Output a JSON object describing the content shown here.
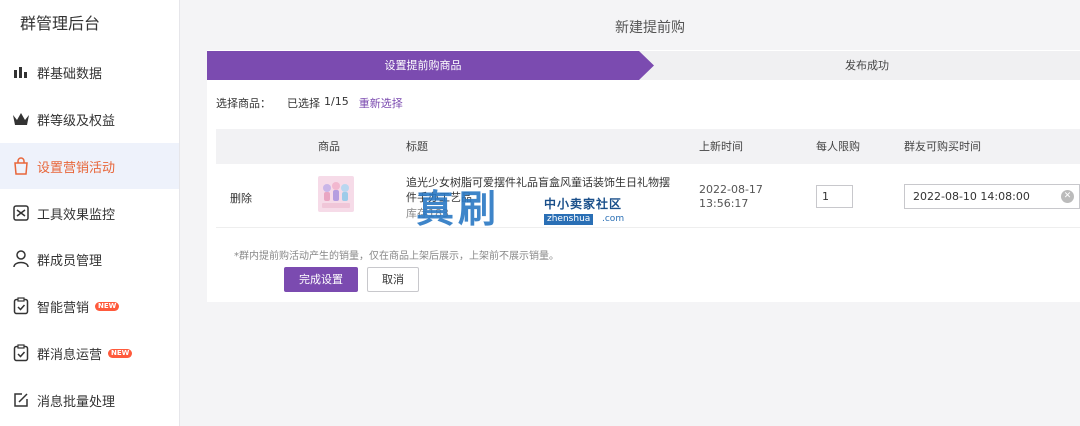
{
  "sidebar": {
    "title": "群管理后台",
    "items": [
      {
        "label": "群基础数据",
        "icon": "bar-chart-icon",
        "active": false,
        "badge": ""
      },
      {
        "label": "群等级及权益",
        "icon": "crown-icon",
        "active": false,
        "badge": ""
      },
      {
        "label": "设置营销活动",
        "icon": "shopping-bag-icon",
        "active": true,
        "badge": ""
      },
      {
        "label": "工具效果监控",
        "icon": "monitor-icon",
        "active": false,
        "badge": ""
      },
      {
        "label": "群成员管理",
        "icon": "user-icon",
        "active": false,
        "badge": ""
      },
      {
        "label": "智能营销",
        "icon": "clipboard-check-icon",
        "active": false,
        "badge": "NEW"
      },
      {
        "label": "群消息运营",
        "icon": "clipboard-check-icon",
        "active": false,
        "badge": "NEW"
      },
      {
        "label": "消息批量处理",
        "icon": "edit-icon",
        "active": false,
        "badge": ""
      }
    ]
  },
  "page": {
    "title": "新建提前购"
  },
  "steps": [
    {
      "label": "设置提前购商品",
      "active": true
    },
    {
      "label": "发布成功",
      "active": false
    }
  ],
  "selection": {
    "label": "选择商品：",
    "selected_text": "已选择",
    "count": "1/15",
    "reselect": "重新选择"
  },
  "table": {
    "headers": [
      "商品",
      "标题",
      "上新时间",
      "每人限购",
      "群友可购买时间"
    ],
    "rows": [
      {
        "action": "删除",
        "title": "追光少女树脂可爱摆件礼品盲盒风童话装饰生日礼物摆件手办工艺品",
        "stock": "库存183",
        "launch_time": "2022-08-17 13:56:17",
        "limit": "1",
        "buy_time": "2022-08-10 14:08:00"
      }
    ]
  },
  "note": "*群内提前购活动产生的销量，仅在商品上架后展示，上架前不展示销量。",
  "buttons": {
    "confirm": "完成设置",
    "cancel": "取消"
  },
  "watermark": {
    "big": "真刷",
    "small": "中小卖家社区",
    "domain": "zhenshua",
    "com": ".com"
  },
  "colors": {
    "accent": "#7b4bb0",
    "active_nav_text": "#e8663a",
    "badge": "#ff5a3c"
  }
}
